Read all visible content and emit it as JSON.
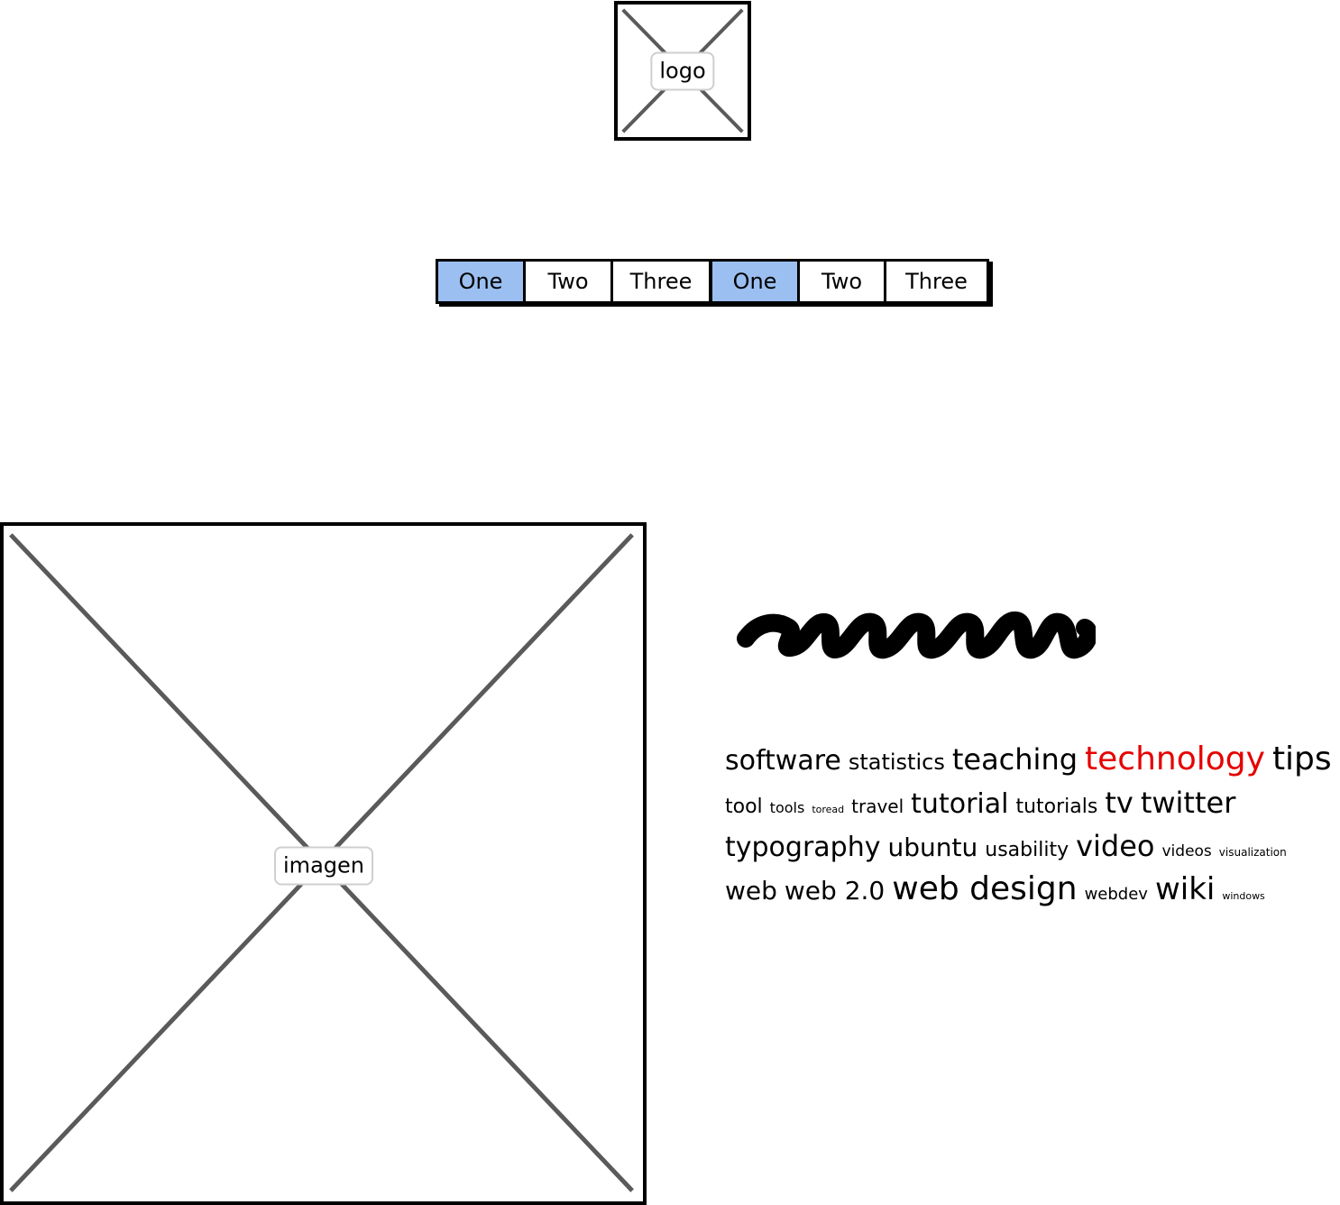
{
  "logo": {
    "label": "logo"
  },
  "tabs_primary": [
    {
      "label": "One",
      "active": true
    },
    {
      "label": "Two",
      "active": false
    },
    {
      "label": "Three",
      "active": false
    }
  ],
  "tabs_secondary": [
    {
      "label": "One",
      "active": true
    },
    {
      "label": "Two",
      "active": false
    },
    {
      "label": "Three",
      "active": false
    }
  ],
  "image": {
    "label": "imagen"
  },
  "colors": {
    "active_tab": "#9bbff0",
    "highlight_tag": "#e60000",
    "placeholder_cross": "#5a5a5a"
  },
  "tag_cloud": {
    "lines": [
      [
        {
          "text": "software",
          "size": 30
        },
        {
          "text": "statistics",
          "size": 24
        },
        {
          "text": "teaching",
          "size": 32
        },
        {
          "text": "technology",
          "size": 36,
          "highlight": true
        },
        {
          "text": "tips",
          "size": 36
        }
      ],
      [
        {
          "text": "tool",
          "size": 22
        },
        {
          "text": "tools",
          "size": 16
        },
        {
          "text": "toread",
          "size": 11
        },
        {
          "text": "travel",
          "size": 20
        },
        {
          "text": "tutorial",
          "size": 30
        },
        {
          "text": "tutorials",
          "size": 22
        },
        {
          "text": "tv",
          "size": 32
        },
        {
          "text": "twitter",
          "size": 32
        }
      ],
      [
        {
          "text": "typography",
          "size": 30
        },
        {
          "text": "ubuntu",
          "size": 28
        },
        {
          "text": "usability",
          "size": 22
        },
        {
          "text": "video",
          "size": 32
        },
        {
          "text": "videos",
          "size": 17
        },
        {
          "text": "visualization",
          "size": 12
        }
      ],
      [
        {
          "text": "web",
          "size": 28
        },
        {
          "text": "web 2.0",
          "size": 28
        },
        {
          "text": "web design",
          "size": 36
        },
        {
          "text": "webdev",
          "size": 18
        },
        {
          "text": "wiki",
          "size": 34
        },
        {
          "text": "windows",
          "size": 11
        }
      ]
    ]
  }
}
